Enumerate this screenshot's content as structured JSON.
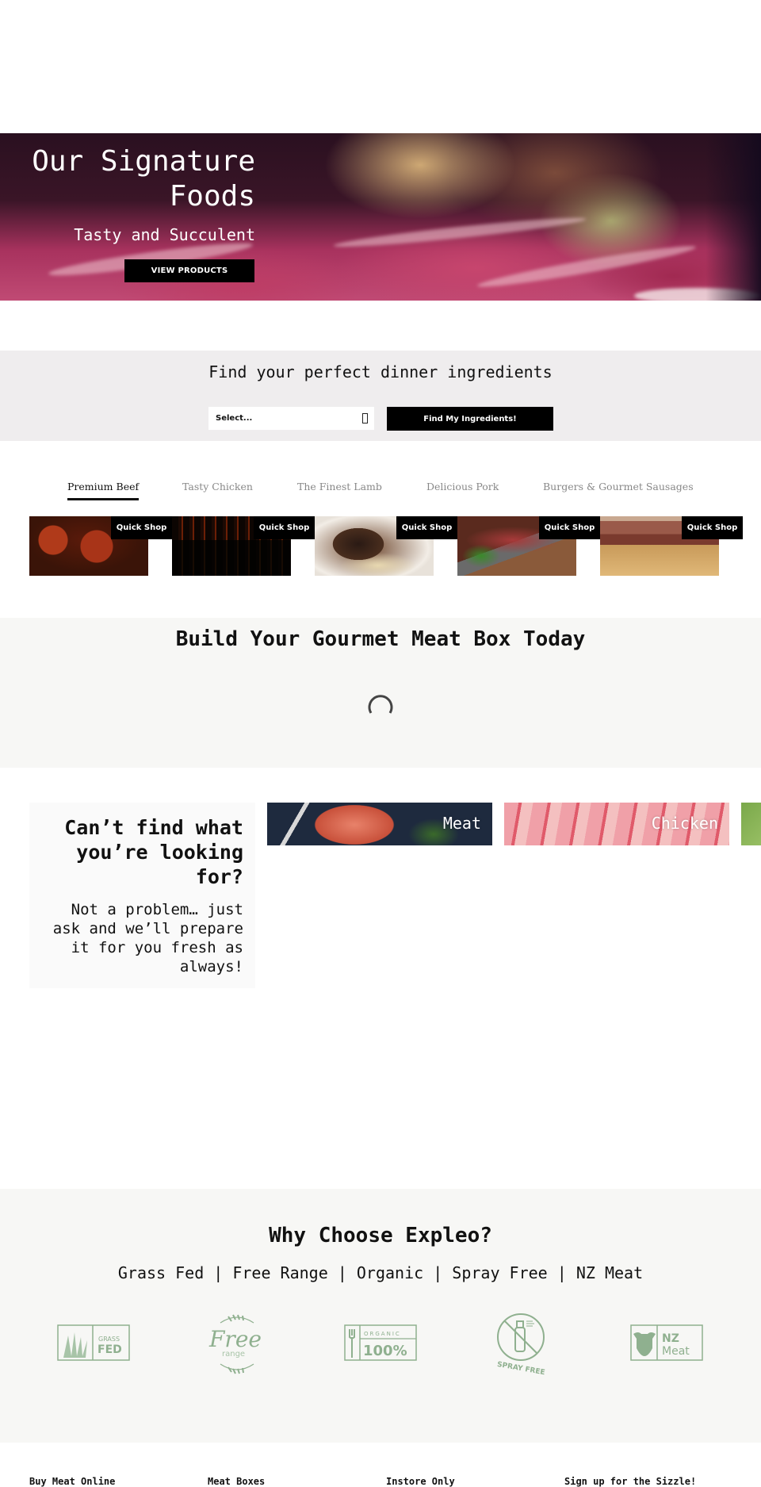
{
  "hero": {
    "title": "Our Signature Foods",
    "subtitle": "Tasty and Succulent",
    "button_label": "VIEW PRODUCTS"
  },
  "finder": {
    "title": "Find your perfect dinner ingredients",
    "select_value": "Select...",
    "button_label": "Find My Ingredients!"
  },
  "tabs": [
    {
      "label": "Premium Beef",
      "active": true
    },
    {
      "label": "Tasty Chicken",
      "active": false
    },
    {
      "label": "The Finest Lamb",
      "active": false
    },
    {
      "label": "Delicious Pork",
      "active": false
    },
    {
      "label": "Burgers & Gourmet Sausages",
      "active": false
    }
  ],
  "products": [
    {
      "image": "meatballs",
      "quick_shop_label": "Quick Shop"
    },
    {
      "image": "grilled-steak",
      "quick_shop_label": "Quick Shop"
    },
    {
      "image": "braised-beef",
      "quick_shop_label": "Quick Shop"
    },
    {
      "image": "sliced-roast-beef",
      "quick_shop_label": "Quick Shop"
    },
    {
      "image": "brisket",
      "quick_shop_label": "Quick Shop"
    }
  ],
  "meat_box": {
    "title": "Build Your Gourmet Meat Box Today",
    "loading_icon": "spinner-icon"
  },
  "cant_find": {
    "title": "Can’t find what you’re looking for?",
    "text": "Not a problem… just ask and we’ll prepare it for you fresh as always!"
  },
  "categories": [
    {
      "label": "Meat"
    },
    {
      "label": "Chicken"
    },
    {
      "label": ""
    }
  ],
  "why": {
    "title": "Why Choose Expleo?",
    "subtitle": "Grass Fed | Free Range | Organic | Spray Free | NZ Meat",
    "badges": [
      {
        "name": "grass-fed-badge",
        "text": [
          "GRASS",
          "FED"
        ]
      },
      {
        "name": "free-range-badge",
        "text": [
          "Free",
          "range"
        ]
      },
      {
        "name": "organic-badge",
        "text": [
          "ORGANIC",
          "100%"
        ]
      },
      {
        "name": "spray-free-badge",
        "text": [
          "SPRAY FREE"
        ]
      },
      {
        "name": "nz-meat-badge",
        "text": [
          "NZ",
          "Meat"
        ]
      }
    ],
    "badge_color": "#8fb08f"
  },
  "footer": {
    "columns": [
      {
        "heading": "Buy Meat Online"
      },
      {
        "heading": "Meat Boxes"
      },
      {
        "heading": "Instore Only"
      },
      {
        "heading": "Sign up for the Sizzle!"
      }
    ]
  }
}
